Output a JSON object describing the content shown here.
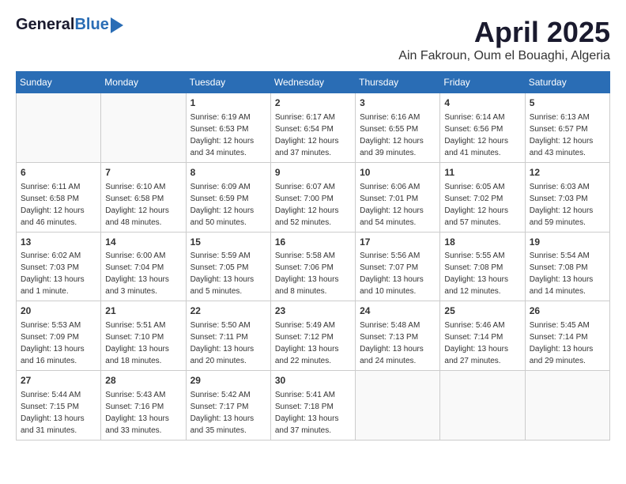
{
  "header": {
    "logo_general": "General",
    "logo_blue": "Blue",
    "month": "April 2025",
    "location": "Ain Fakroun, Oum el Bouaghi, Algeria"
  },
  "columns": [
    "Sunday",
    "Monday",
    "Tuesday",
    "Wednesday",
    "Thursday",
    "Friday",
    "Saturday"
  ],
  "weeks": [
    [
      {
        "day": "",
        "info": ""
      },
      {
        "day": "",
        "info": ""
      },
      {
        "day": "1",
        "info": "Sunrise: 6:19 AM\nSunset: 6:53 PM\nDaylight: 12 hours\nand 34 minutes."
      },
      {
        "day": "2",
        "info": "Sunrise: 6:17 AM\nSunset: 6:54 PM\nDaylight: 12 hours\nand 37 minutes."
      },
      {
        "day": "3",
        "info": "Sunrise: 6:16 AM\nSunset: 6:55 PM\nDaylight: 12 hours\nand 39 minutes."
      },
      {
        "day": "4",
        "info": "Sunrise: 6:14 AM\nSunset: 6:56 PM\nDaylight: 12 hours\nand 41 minutes."
      },
      {
        "day": "5",
        "info": "Sunrise: 6:13 AM\nSunset: 6:57 PM\nDaylight: 12 hours\nand 43 minutes."
      }
    ],
    [
      {
        "day": "6",
        "info": "Sunrise: 6:11 AM\nSunset: 6:58 PM\nDaylight: 12 hours\nand 46 minutes."
      },
      {
        "day": "7",
        "info": "Sunrise: 6:10 AM\nSunset: 6:58 PM\nDaylight: 12 hours\nand 48 minutes."
      },
      {
        "day": "8",
        "info": "Sunrise: 6:09 AM\nSunset: 6:59 PM\nDaylight: 12 hours\nand 50 minutes."
      },
      {
        "day": "9",
        "info": "Sunrise: 6:07 AM\nSunset: 7:00 PM\nDaylight: 12 hours\nand 52 minutes."
      },
      {
        "day": "10",
        "info": "Sunrise: 6:06 AM\nSunset: 7:01 PM\nDaylight: 12 hours\nand 54 minutes."
      },
      {
        "day": "11",
        "info": "Sunrise: 6:05 AM\nSunset: 7:02 PM\nDaylight: 12 hours\nand 57 minutes."
      },
      {
        "day": "12",
        "info": "Sunrise: 6:03 AM\nSunset: 7:03 PM\nDaylight: 12 hours\nand 59 minutes."
      }
    ],
    [
      {
        "day": "13",
        "info": "Sunrise: 6:02 AM\nSunset: 7:03 PM\nDaylight: 13 hours\nand 1 minute."
      },
      {
        "day": "14",
        "info": "Sunrise: 6:00 AM\nSunset: 7:04 PM\nDaylight: 13 hours\nand 3 minutes."
      },
      {
        "day": "15",
        "info": "Sunrise: 5:59 AM\nSunset: 7:05 PM\nDaylight: 13 hours\nand 5 minutes."
      },
      {
        "day": "16",
        "info": "Sunrise: 5:58 AM\nSunset: 7:06 PM\nDaylight: 13 hours\nand 8 minutes."
      },
      {
        "day": "17",
        "info": "Sunrise: 5:56 AM\nSunset: 7:07 PM\nDaylight: 13 hours\nand 10 minutes."
      },
      {
        "day": "18",
        "info": "Sunrise: 5:55 AM\nSunset: 7:08 PM\nDaylight: 13 hours\nand 12 minutes."
      },
      {
        "day": "19",
        "info": "Sunrise: 5:54 AM\nSunset: 7:08 PM\nDaylight: 13 hours\nand 14 minutes."
      }
    ],
    [
      {
        "day": "20",
        "info": "Sunrise: 5:53 AM\nSunset: 7:09 PM\nDaylight: 13 hours\nand 16 minutes."
      },
      {
        "day": "21",
        "info": "Sunrise: 5:51 AM\nSunset: 7:10 PM\nDaylight: 13 hours\nand 18 minutes."
      },
      {
        "day": "22",
        "info": "Sunrise: 5:50 AM\nSunset: 7:11 PM\nDaylight: 13 hours\nand 20 minutes."
      },
      {
        "day": "23",
        "info": "Sunrise: 5:49 AM\nSunset: 7:12 PM\nDaylight: 13 hours\nand 22 minutes."
      },
      {
        "day": "24",
        "info": "Sunrise: 5:48 AM\nSunset: 7:13 PM\nDaylight: 13 hours\nand 24 minutes."
      },
      {
        "day": "25",
        "info": "Sunrise: 5:46 AM\nSunset: 7:14 PM\nDaylight: 13 hours\nand 27 minutes."
      },
      {
        "day": "26",
        "info": "Sunrise: 5:45 AM\nSunset: 7:14 PM\nDaylight: 13 hours\nand 29 minutes."
      }
    ],
    [
      {
        "day": "27",
        "info": "Sunrise: 5:44 AM\nSunset: 7:15 PM\nDaylight: 13 hours\nand 31 minutes."
      },
      {
        "day": "28",
        "info": "Sunrise: 5:43 AM\nSunset: 7:16 PM\nDaylight: 13 hours\nand 33 minutes."
      },
      {
        "day": "29",
        "info": "Sunrise: 5:42 AM\nSunset: 7:17 PM\nDaylight: 13 hours\nand 35 minutes."
      },
      {
        "day": "30",
        "info": "Sunrise: 5:41 AM\nSunset: 7:18 PM\nDaylight: 13 hours\nand 37 minutes."
      },
      {
        "day": "",
        "info": ""
      },
      {
        "day": "",
        "info": ""
      },
      {
        "day": "",
        "info": ""
      }
    ]
  ]
}
